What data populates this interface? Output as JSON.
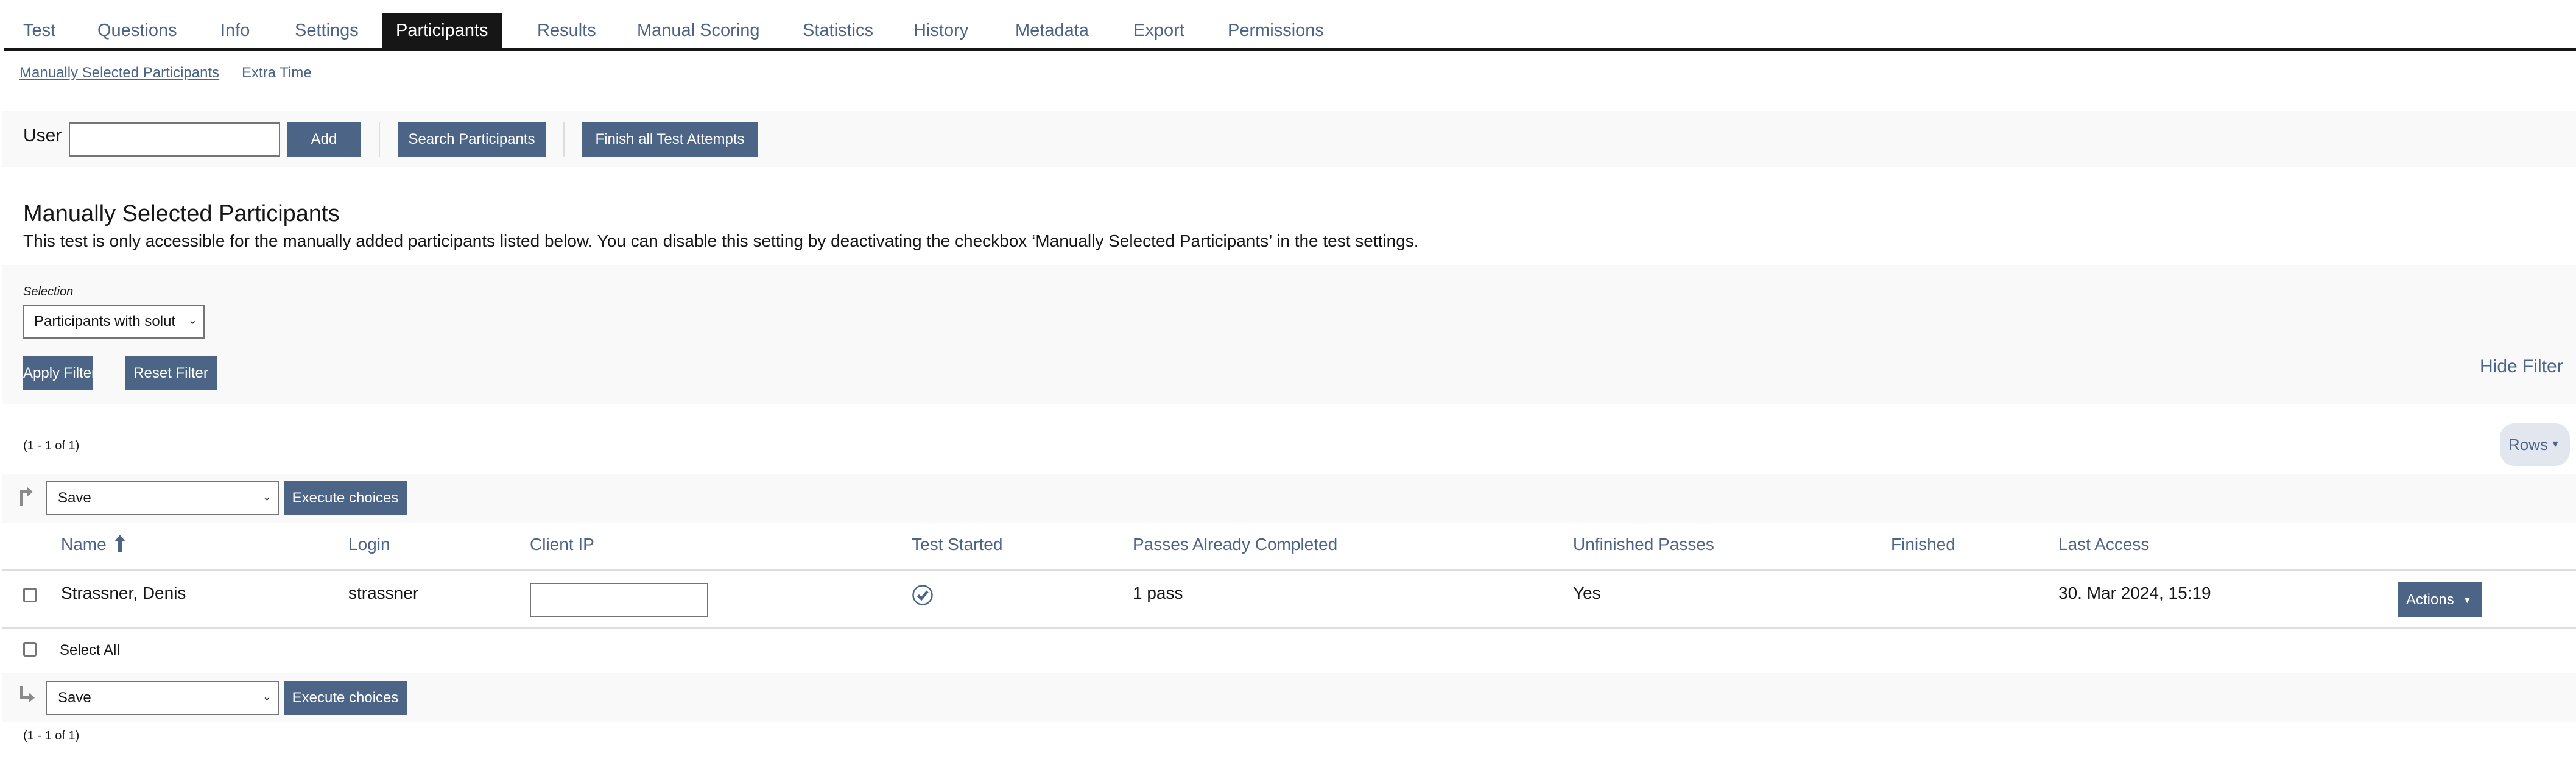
{
  "tabs": [
    {
      "label": "Test",
      "active": false
    },
    {
      "label": "Questions",
      "active": false
    },
    {
      "label": "Info",
      "active": false
    },
    {
      "label": "Settings",
      "active": false
    },
    {
      "label": "Participants",
      "active": true
    },
    {
      "label": "Results",
      "active": false
    },
    {
      "label": "Manual Scoring",
      "active": false
    },
    {
      "label": "Statistics",
      "active": false
    },
    {
      "label": "History",
      "active": false
    },
    {
      "label": "Metadata",
      "active": false
    },
    {
      "label": "Export",
      "active": false
    },
    {
      "label": "Permissions",
      "active": false
    }
  ],
  "subtabs": [
    {
      "label": "Manually Selected Participants",
      "active": true
    },
    {
      "label": "Extra Time",
      "active": false
    }
  ],
  "toolbar": {
    "user_label": "User",
    "user_value": "",
    "add_label": "Add",
    "search_label": "Search Participants",
    "finish_label": "Finish all Test Attempts"
  },
  "section": {
    "title": "Manually Selected Participants",
    "description": "This test is only accessible for the manually added participants listed below. You can disable this setting by deactivating the checkbox ‘Manually Selected Participants’ in the test settings."
  },
  "filter": {
    "selection_label": "Selection",
    "selection_value": "Participants with solut",
    "apply_label": "Apply Filter",
    "reset_label": "Reset Filter",
    "hide_label": "Hide Filter"
  },
  "pagination": {
    "top": "(1 - 1 of 1)",
    "bottom": "(1 - 1 of 1)",
    "rows_label": "Rows"
  },
  "bulk_actions": {
    "select_value": "Save",
    "execute_label": "Execute choices",
    "select_all_label": "Select All"
  },
  "table": {
    "columns": [
      "Name",
      "Login",
      "Client IP",
      "Test Started",
      "Passes Already Completed",
      "Unfinished Passes",
      "Finished",
      "Last Access"
    ],
    "sort_column": "Name",
    "sort_direction": "ascending",
    "rows": [
      {
        "name": "Strassner, Denis",
        "login": "strassner",
        "client_ip": "",
        "test_started": true,
        "passes_completed": "1 pass",
        "unfinished_passes": "Yes",
        "finished": "",
        "last_access": "30. Mar 2024, 15:19",
        "actions_label": "Actions"
      }
    ]
  },
  "colors": {
    "accent": "#4c6586",
    "active_tab": "#161616",
    "band": "#f9f9f9",
    "rows_button": "#e2e7ef"
  }
}
